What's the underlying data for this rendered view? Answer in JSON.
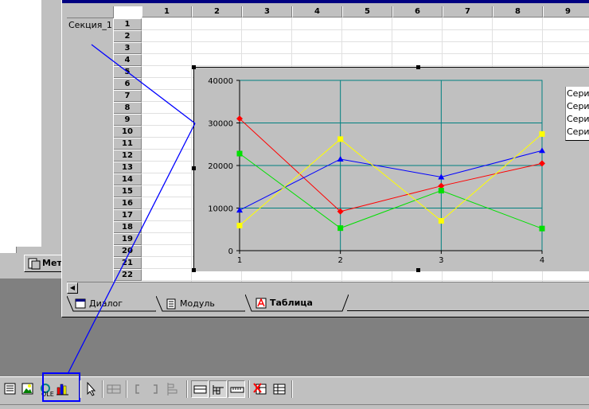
{
  "left_window": {
    "tab_label": "Мет"
  },
  "sheet": {
    "section_label": "Секция_1",
    "columns": [
      "1",
      "2",
      "3",
      "4",
      "5",
      "6",
      "7",
      "8",
      "9"
    ],
    "rows": [
      "1",
      "2",
      "3",
      "4",
      "5",
      "6",
      "7",
      "8",
      "9",
      "10",
      "11",
      "12",
      "13",
      "14",
      "15",
      "16",
      "17",
      "18",
      "19",
      "20",
      "21",
      "22"
    ]
  },
  "tabs": [
    {
      "label": "Диалог",
      "icon": "dialog-icon"
    },
    {
      "label": "Модуль",
      "icon": "module-icon"
    },
    {
      "label": "Таблица",
      "icon": "table-icon",
      "active": true
    }
  ],
  "chart_data": {
    "type": "line",
    "x": [
      1,
      2,
      3,
      4
    ],
    "xlim": [
      1,
      4
    ],
    "ylim": [
      0,
      40000
    ],
    "yticks": [
      "0",
      "10000",
      "20000",
      "30000",
      "40000"
    ],
    "xticks": [
      "1",
      "2",
      "3",
      "4"
    ],
    "plot_background": "#c0c0c0",
    "grid_color": "#008080",
    "legend": [
      "Сери",
      "Сери",
      "Сери",
      "Сери"
    ],
    "series": [
      {
        "color": "#ff0000",
        "marker": "diamond",
        "values": [
          31000,
          9200,
          15200,
          20500
        ]
      },
      {
        "color": "#0000ff",
        "marker": "triangle",
        "values": [
          9500,
          21500,
          17300,
          23500
        ]
      },
      {
        "color": "#00e000",
        "marker": "square",
        "values": [
          22800,
          5300,
          14100,
          5200
        ]
      },
      {
        "color": "#ffff00",
        "marker": "square",
        "values": [
          5900,
          26200,
          7000,
          27400
        ]
      }
    ]
  },
  "toolbar": {
    "icons": [
      "text-icon",
      "picture-icon",
      "ole-object-icon",
      "chart-icon",
      "pointer-icon",
      "grid-icon",
      "bracket-left-icon",
      "bracket-right-icon",
      "align-icon",
      "view1-icon",
      "view2-icon",
      "view3-icon",
      "delete-cells-icon",
      "table-props-icon"
    ]
  },
  "colors": {
    "highlight": "#0000ff",
    "annotation_line": "#0000ff"
  }
}
